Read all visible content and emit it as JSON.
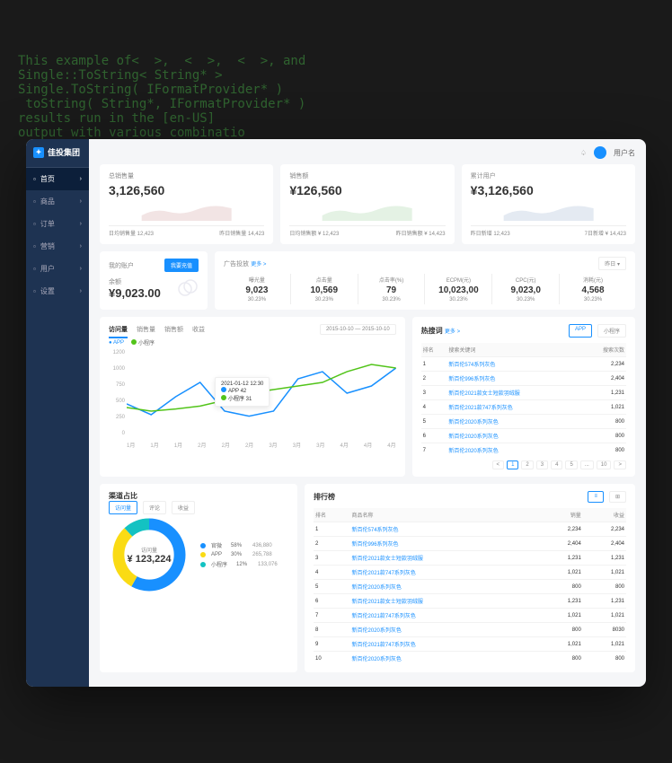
{
  "bg_code": "This example of<  >,  <  >,  <  >, and\nSingle::ToString< String* >\nSingle.ToString( IFormatProvider* )\n toString( String*, IFormatProvider* )\nresults run in the [en-US]\noutput with various combinatio",
  "brand": "佳投集团",
  "topbar": {
    "username": "用户名"
  },
  "sidebar": {
    "items": [
      {
        "icon": "home",
        "label": "首页",
        "active": true
      },
      {
        "icon": "goods",
        "label": "商品"
      },
      {
        "icon": "order",
        "label": "订单"
      },
      {
        "icon": "marketing",
        "label": "营销"
      },
      {
        "icon": "user",
        "label": "用户"
      },
      {
        "icon": "settings",
        "label": "设置"
      }
    ]
  },
  "kpis": [
    {
      "label": "总销售量",
      "value": "3,126,560",
      "foot_l_label": "日均销售量",
      "foot_l_val": "12,423",
      "foot_r_label": "昨日销售量",
      "foot_r_val": "14,423",
      "color": "#d3a4a4"
    },
    {
      "label": "销售额",
      "value": "¥126,560",
      "foot_l_label": "日均销售额",
      "foot_l_val": "¥ 12,423",
      "foot_r_label": "昨日销售额",
      "foot_r_val": "¥ 14,423",
      "color": "#a4d3a4"
    },
    {
      "label": "累计用户",
      "value": "¥3,126,560",
      "foot_l_label": "昨日新增",
      "foot_l_val": "12,423",
      "foot_r_label": "7日新增",
      "foot_r_val": "¥ 14,423",
      "color": "#a4b8d3"
    }
  ],
  "wallet": {
    "title": "我的账户",
    "btn": "我要充值",
    "label": "余额",
    "value": "¥9,023.00"
  },
  "ad": {
    "title": "广告投放",
    "more": "更多 >",
    "period": "昨日",
    "metrics": [
      {
        "label": "曝光量",
        "value": "9,023",
        "sub": "30.23%"
      },
      {
        "label": "点击量",
        "value": "10,569",
        "sub": "30.23%"
      },
      {
        "label": "点击率(%)",
        "value": "79",
        "sub": "30.23%"
      },
      {
        "label": "ECPM(元)",
        "value": "10,023,00",
        "sub": "30.23%"
      },
      {
        "label": "CPC(元)",
        "value": "9,023,0",
        "sub": "30.23%"
      },
      {
        "label": "消耗(元)",
        "value": "4,568",
        "sub": "30.23%"
      }
    ]
  },
  "traffic": {
    "tabs": [
      "访问量",
      "销售量",
      "销售额",
      "收益"
    ],
    "date": "2015-10-10 — 2015-10-10",
    "legend": [
      {
        "name": "APP",
        "color": "#1890ff"
      },
      {
        "name": "小程序",
        "color": "#52c41a"
      }
    ],
    "y_ticks": [
      "1200",
      "1000",
      "750",
      "500",
      "250",
      "0"
    ],
    "x_ticks": [
      "1月",
      "1月",
      "1月",
      "2月",
      "2月",
      "2月",
      "3月",
      "3月",
      "3月",
      "4月",
      "4月",
      "4月"
    ],
    "tooltip": {
      "date": "2021-01-12 12:30",
      "app": "APP  42",
      "mini": "小程序  31"
    }
  },
  "chart_data": {
    "traffic_line": {
      "type": "line",
      "x": [
        "1月",
        "1月",
        "1月",
        "2月",
        "2月",
        "2月",
        "3月",
        "3月",
        "3月",
        "4月",
        "4月",
        "4月"
      ],
      "series": [
        {
          "name": "APP",
          "color": "#1890ff",
          "values": [
            450,
            300,
            550,
            750,
            350,
            280,
            350,
            800,
            900,
            600,
            700,
            950
          ]
        },
        {
          "name": "小程序",
          "color": "#52c41a",
          "values": [
            400,
            350,
            380,
            420,
            500,
            600,
            650,
            700,
            750,
            900,
            1000,
            950
          ]
        }
      ],
      "ylim": [
        0,
        1200
      ]
    },
    "channel_pie": {
      "type": "pie",
      "title": "访问量",
      "total": "¥ 123,224",
      "series": [
        {
          "name": "官微",
          "pct": 58,
          "value": "436,880",
          "color": "#1890ff"
        },
        {
          "name": "APP",
          "pct": 30,
          "value": "265,788",
          "color": "#fadb14"
        },
        {
          "name": "小程序",
          "pct": 12,
          "value": "133,076",
          "color": "#13c2c2"
        }
      ]
    }
  },
  "hot_search": {
    "title": "热搜词",
    "more": "更多 >",
    "tabs": [
      "APP",
      "小程序"
    ],
    "headers": [
      "排名",
      "搜索关键词",
      "搜索次数"
    ],
    "rows": [
      {
        "rank": "1",
        "kw": "新百伦574系列灰色",
        "count": "2,234"
      },
      {
        "rank": "2",
        "kw": "新百伦996系列灰色",
        "count": "2,404"
      },
      {
        "rank": "3",
        "kw": "新百伦2021款女士短款羽绒服",
        "count": "1,231"
      },
      {
        "rank": "4",
        "kw": "新百伦2021款747系列灰色",
        "count": "1,021"
      },
      {
        "rank": "5",
        "kw": "新百伦2020系列灰色",
        "count": "800"
      },
      {
        "rank": "6",
        "kw": "新百伦2020系列灰色",
        "count": "800"
      },
      {
        "rank": "7",
        "kw": "新百伦2020系列灰色",
        "count": "800"
      }
    ],
    "pages": [
      "<",
      "1",
      "2",
      "3",
      "4",
      "5",
      "...",
      "10",
      ">"
    ]
  },
  "channel": {
    "title": "渠道占比",
    "tabs": [
      "访问量",
      "评论",
      "收益"
    ]
  },
  "rank": {
    "title": "排行榜",
    "tabs_icons": [
      "list",
      "grid"
    ],
    "headers": [
      "排名",
      "商品名称",
      "销量",
      "收益"
    ],
    "rows": [
      {
        "rank": "1",
        "name": "新百伦574系列灰色",
        "sales": "2,234",
        "rev": "2,234"
      },
      {
        "rank": "2",
        "name": "新百伦996系列灰色",
        "sales": "2,404",
        "rev": "2,404"
      },
      {
        "rank": "3",
        "name": "新百伦2021款女士短款羽绒服",
        "sales": "1,231",
        "rev": "1,231"
      },
      {
        "rank": "4",
        "name": "新百伦2021款747系列灰色",
        "sales": "1,021",
        "rev": "1,021"
      },
      {
        "rank": "5",
        "name": "新百伦2020系列灰色",
        "sales": "800",
        "rev": "800"
      },
      {
        "rank": "6",
        "name": "新百伦2021款女士短款羽绒服",
        "sales": "1,231",
        "rev": "1,231"
      },
      {
        "rank": "7",
        "name": "新百伦2021款747系列灰色",
        "sales": "1,021",
        "rev": "1,021"
      },
      {
        "rank": "8",
        "name": "新百伦2020系列灰色",
        "sales": "800",
        "rev": "8030"
      },
      {
        "rank": "9",
        "name": "新百伦2021款747系列灰色",
        "sales": "1,021",
        "rev": "1,021"
      },
      {
        "rank": "10",
        "name": "新百伦2020系列灰色",
        "sales": "800",
        "rev": "800"
      }
    ]
  }
}
